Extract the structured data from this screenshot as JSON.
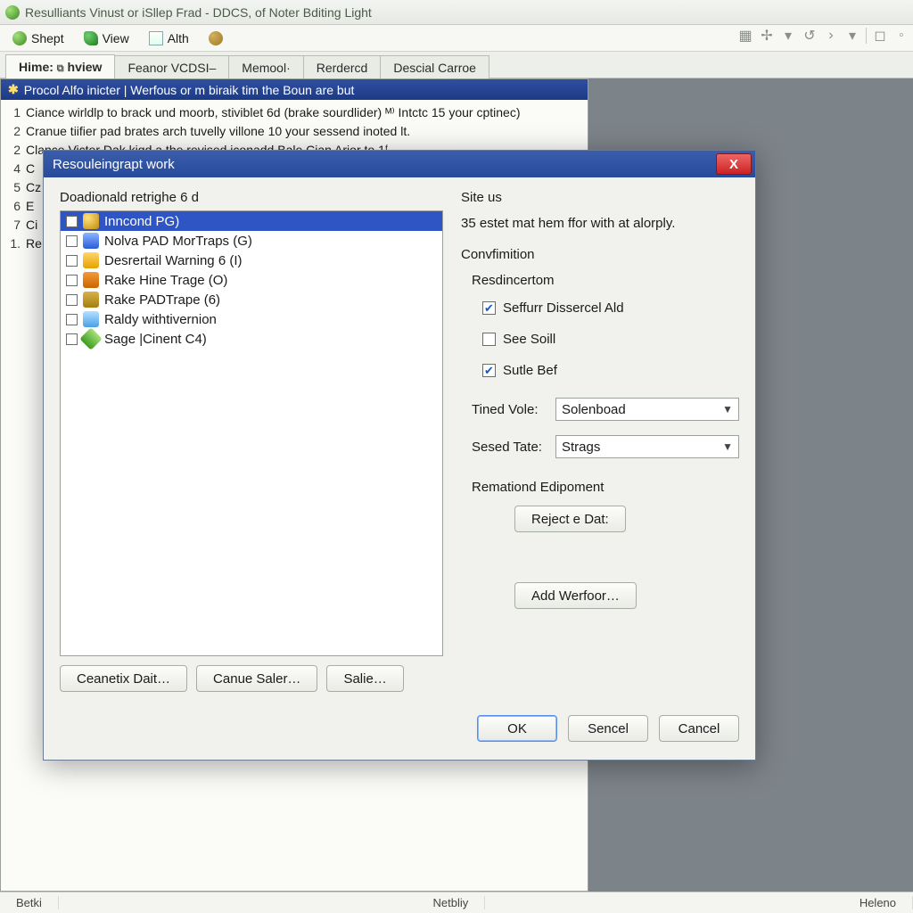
{
  "window": {
    "title": "Resulliants Vinust or iSllep Frad - DDCS, of Noter Bditing Light"
  },
  "menubar": {
    "items": [
      {
        "label": "Shept"
      },
      {
        "label": "View"
      },
      {
        "label": "Alth"
      }
    ]
  },
  "tabs": [
    {
      "label": "Hime:",
      "suffix": "hview",
      "active": true
    },
    {
      "label": "Feanor VCDSI–"
    },
    {
      "label": "Memool·"
    },
    {
      "label": "Rerdercd"
    },
    {
      "label": "Descial Carroe "
    }
  ],
  "document": {
    "header": "Procol Alfo inicter | Werfous or m biraik tim the Boun are but",
    "lines": [
      {
        "n": "1",
        "text": "Ciance wirldlp to brack und moorb, stiviblet 6d (brake sourdlider) ᴹ⁾ Intctc 15 your cptinec)"
      },
      {
        "n": "2",
        "text": "Cranue tiifier pad brates arch tuvelly villone 10 your sessend inoted lt."
      },
      {
        "n": "2",
        "text": "Clance Victer Dak kigd a the revised iconadd Bale Cian Arior to 1ᶠ"
      },
      {
        "n": "4",
        "text": "C"
      },
      {
        "n": "5",
        "text": "Cz"
      },
      {
        "n": "6",
        "text": "E"
      },
      {
        "n": "7",
        "text": "Ci"
      },
      {
        "n": "1.",
        "text": "Re"
      }
    ]
  },
  "statusbar": {
    "cells": [
      "Betki",
      "",
      "Netbliy",
      "",
      "Heleno"
    ]
  },
  "dialog": {
    "title": "Resouleingrapt work",
    "left_label": "Doadionald retrighe 6 d",
    "items": [
      {
        "label": "Inncond PG)",
        "selected": true,
        "icon": "a"
      },
      {
        "label": "Nolva PAD MorTraps (G)",
        "icon": "b"
      },
      {
        "label": "Desrertail Warning 6 (I)",
        "icon": "c"
      },
      {
        "label": "Rake Hine Trage (O)",
        "icon": "d"
      },
      {
        "label": "Rake PADTrape (6)",
        "icon": "e"
      },
      {
        "label": "Raldy withtivernion",
        "icon": "f"
      },
      {
        "label": "Sage |Cinent C4)",
        "icon": "g"
      }
    ],
    "left_buttons": {
      "b1": "Ceanetix Dait…",
      "b2": "Canue Saler…",
      "b3": "Salie…"
    },
    "right": {
      "heading": "Site us",
      "hint": "35 estet mat hem ffor with at alorply.",
      "confirm": "Convfimition",
      "resd": "Resdincertom",
      "chk1": "Seffurr Dissercel Ald",
      "chk2": "See Soill",
      "chk3": "Sutle Bef",
      "tined_label": "Tined Vole:",
      "tined_value": "Solenboad",
      "sesed_label": "Sesed Tate:",
      "sesed_value": "Strags",
      "rem_label": "Remationd Edipoment",
      "reject_btn": "Reject e Dat:",
      "add_btn": "Add Werfoor…"
    },
    "footer": {
      "ok": "OK",
      "sencel": "Sencel",
      "cancel": "Cancel"
    }
  }
}
